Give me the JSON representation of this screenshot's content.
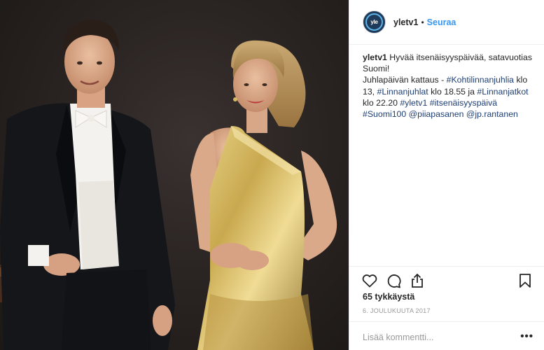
{
  "photo": {
    "description_icon": "post-image"
  },
  "header": {
    "avatar_text": "yle",
    "username": "yletv1",
    "separator": "•",
    "follow_label": "Seuraa"
  },
  "caption": {
    "username": "yletv1",
    "line1": "Hyvää itsenäisyyspäivää, satavuotias Suomi!",
    "part1": "Juhlapäivän kattaus - ",
    "tag1": "#Kohtilinnanjuhlia",
    "part2": " klo 13, ",
    "tag2": "#Linnanjuhlat",
    "part3": " klo 18.55 ja ",
    "tag3": "#Linnanjatkot",
    "part4": " klo 22.20 ",
    "tag4": "#yletv1",
    "tag5": "#itsenäisyyspäivä",
    "tag6": "#Suomi100",
    "mention1": "@piiapasanen",
    "mention2": "@jp.rantanen"
  },
  "actions": {
    "like_icon": "heart-icon",
    "comment_icon": "comment-icon",
    "share_icon": "share-icon",
    "save_icon": "bookmark-icon",
    "likes": "65 tykkäystä",
    "date": "6. JOULUKUUTA 2017"
  },
  "comment": {
    "placeholder": "Lisää kommentti...",
    "more_label": "•••"
  },
  "colors": {
    "link": "#1e3f74",
    "follow": "#3897f0",
    "muted": "#999999",
    "border": "#efefef"
  }
}
